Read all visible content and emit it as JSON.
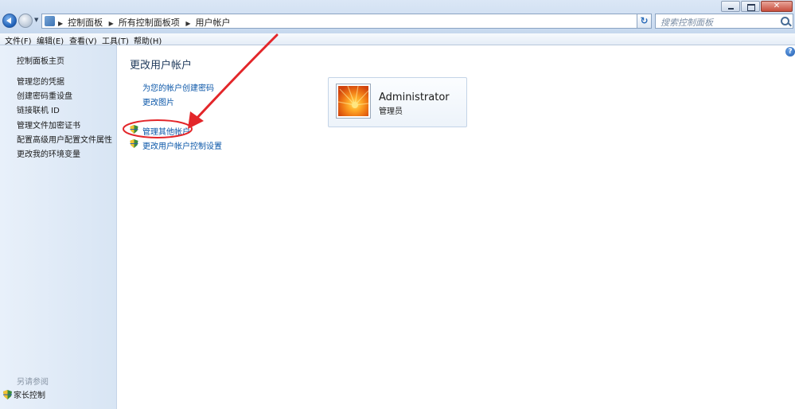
{
  "window": {
    "breadcrumbs": [
      "控制面板",
      "所有控制面板项",
      "用户帐户"
    ],
    "search_placeholder": "搜索控制面板",
    "close_glyph": "✕"
  },
  "menu": [
    {
      "label": "文件(F)"
    },
    {
      "label": "编辑(E)"
    },
    {
      "label": "查看(V)"
    },
    {
      "label": "工具(T)"
    },
    {
      "label": "帮助(H)"
    }
  ],
  "sidebar": {
    "home": "控制面板主页",
    "items": [
      {
        "label": "管理您的凭据"
      },
      {
        "label": "创建密码重设盘"
      },
      {
        "label": "链接联机 ID"
      },
      {
        "label": "管理文件加密证书"
      },
      {
        "label": "配置高级用户配置文件属性"
      },
      {
        "label": "更改我的环境变量"
      }
    ],
    "see_also": "另请参阅",
    "family": "家长控制"
  },
  "main": {
    "title": "更改用户帐户",
    "tasks": [
      {
        "label": "为您的帐户创建密码"
      },
      {
        "label": "更改图片"
      }
    ],
    "shield_tasks": [
      {
        "label": "管理其他帐户"
      },
      {
        "label": "更改用户帐户控制设置"
      }
    ],
    "help": "?"
  },
  "account": {
    "name": "Administrator",
    "role": "管理员"
  },
  "colors": {
    "link": "#0a56a8",
    "annotation": "#e3262a"
  }
}
